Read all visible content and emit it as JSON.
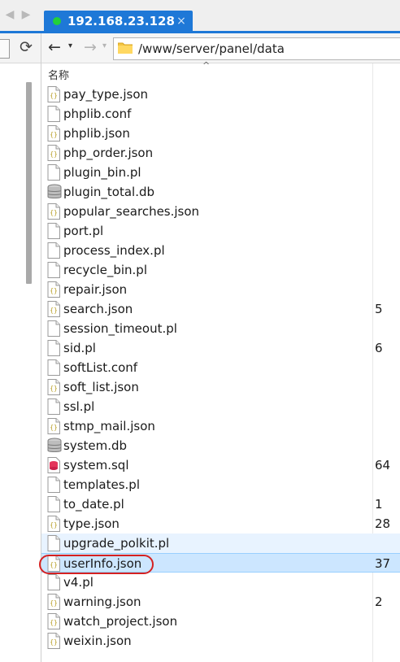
{
  "tab": {
    "title": "192.168.23.128",
    "close_label": "×"
  },
  "address": {
    "path": "/www/server/panel/data"
  },
  "list_header": {
    "name": "名称",
    "sort_indicator": "^"
  },
  "files": [
    {
      "name": "pay_type.json",
      "icon": "json-file-icon",
      "size": ""
    },
    {
      "name": "phplib.conf",
      "icon": "document-file-icon",
      "size": ""
    },
    {
      "name": "phplib.json",
      "icon": "json-file-icon",
      "size": ""
    },
    {
      "name": "php_order.json",
      "icon": "json-file-icon",
      "size": ""
    },
    {
      "name": "plugin_bin.pl",
      "icon": "document-file-icon",
      "size": ""
    },
    {
      "name": "plugin_total.db",
      "icon": "database-file-icon",
      "size": ""
    },
    {
      "name": "popular_searches.json",
      "icon": "json-file-icon",
      "size": ""
    },
    {
      "name": "port.pl",
      "icon": "document-file-icon",
      "size": ""
    },
    {
      "name": "process_index.pl",
      "icon": "document-file-icon",
      "size": ""
    },
    {
      "name": "recycle_bin.pl",
      "icon": "document-file-icon",
      "size": ""
    },
    {
      "name": "repair.json",
      "icon": "json-file-icon",
      "size": ""
    },
    {
      "name": "search.json",
      "icon": "json-file-icon",
      "size": "5"
    },
    {
      "name": "session_timeout.pl",
      "icon": "document-file-icon",
      "size": ""
    },
    {
      "name": "sid.pl",
      "icon": "document-file-icon",
      "size": "6"
    },
    {
      "name": "softList.conf",
      "icon": "document-file-icon",
      "size": ""
    },
    {
      "name": "soft_list.json",
      "icon": "json-file-icon",
      "size": ""
    },
    {
      "name": "ssl.pl",
      "icon": "document-file-icon",
      "size": ""
    },
    {
      "name": "stmp_mail.json",
      "icon": "json-file-icon",
      "size": ""
    },
    {
      "name": "system.db",
      "icon": "database-file-icon",
      "size": ""
    },
    {
      "name": "system.sql",
      "icon": "sql-file-icon",
      "size": "64"
    },
    {
      "name": "templates.pl",
      "icon": "document-file-icon",
      "size": ""
    },
    {
      "name": "to_date.pl",
      "icon": "document-file-icon",
      "size": "1"
    },
    {
      "name": "type.json",
      "icon": "json-file-icon",
      "size": "28"
    },
    {
      "name": "upgrade_polkit.pl",
      "icon": "document-file-icon",
      "size": "",
      "state": "hover"
    },
    {
      "name": "userInfo.json",
      "icon": "json-file-icon",
      "size": "37",
      "state": "selected"
    },
    {
      "name": "v4.pl",
      "icon": "document-file-icon",
      "size": ""
    },
    {
      "name": "warning.json",
      "icon": "json-file-icon",
      "size": "2"
    },
    {
      "name": "watch_project.json",
      "icon": "json-file-icon",
      "size": ""
    },
    {
      "name": "weixin.json",
      "icon": "json-file-icon",
      "size": ""
    }
  ],
  "colors": {
    "tab_active": "#1e78d7",
    "status_dot": "#22d13a",
    "row_hover": "#e8f3ff",
    "row_selected": "#cce6ff",
    "annotation": "#d52121"
  }
}
